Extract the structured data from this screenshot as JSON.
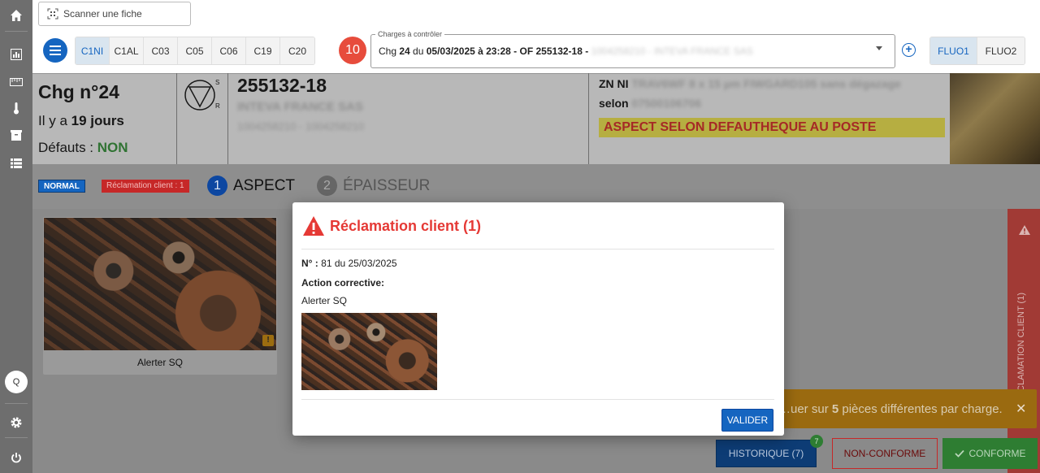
{
  "scan": {
    "label": "Scanner une fiche"
  },
  "tabs": [
    "C1NI",
    "C1AL",
    "C03",
    "C05",
    "C06",
    "C19",
    "C20"
  ],
  "selected_tab": "C1NI",
  "count_badge": "10",
  "charges": {
    "legend": "Charges à contrôler",
    "prefix": "Chg ",
    "num": "24",
    "mid": " du ",
    "date": "05/03/2025 à 23:28",
    "of_sep": " - OF ",
    "of": "255132-18",
    "dash": " - ",
    "blurred": "1004258210 - INTEVA FRANCE SAS"
  },
  "fluo_tabs": [
    "FLUO1",
    "FLUO2"
  ],
  "info": {
    "chg_title": "Chg n°24",
    "ago_prefix": "Il y a ",
    "ago_value": "19 jours",
    "defauts_label": "Défauts : ",
    "defauts_value": "NON",
    "symbol_s": "S",
    "symbol_r": "R",
    "of_number": "255132-18",
    "client_blurred": "INTEVA FRANCE SAS",
    "refs_blurred": "1004258210 - 1004258210",
    "zn_label": "ZN NI ",
    "zn_blurred": "TRAV6WF 8 x 15 µm FIWGARD105 sans dégazage",
    "selon_label": "selon ",
    "selon_blurred": "07500106706",
    "aspect_banner": "ASPECT SELON DEFAUTHEQUE AU POSTE"
  },
  "tags": {
    "normal": "NORMAL",
    "reclamation": "Réclamation client : 1"
  },
  "steps": [
    {
      "num": "1",
      "label": "ASPECT"
    },
    {
      "num": "2",
      "label": "ÉPAISSEUR"
    }
  ],
  "card": {
    "label": "Alerter SQ"
  },
  "side_panel": {
    "label": "RÉCLAMATION CLIENT (1)"
  },
  "toast": {
    "text_pre": "…uer sur ",
    "bold": "5",
    "text_post": " pièces différentes par charge.",
    "close": "✕"
  },
  "actions": {
    "historique": "HISTORIQUE (7)",
    "hist_badge": "7",
    "non_conforme": "NON-CONFORME",
    "conforme": "CONFORME"
  },
  "modal": {
    "title": "Réclamation client (1)",
    "num_label": "N° : ",
    "num_value": "81 du 25/03/2025",
    "action_label": "Action corrective:",
    "action_value": "Alerter SQ",
    "valider": "VALIDER"
  },
  "rail": {
    "q": "Q"
  },
  "colors": {
    "brand": "#1565c0",
    "danger": "#e53935",
    "success": "#2e7d32",
    "warning": "#fdf25a"
  }
}
